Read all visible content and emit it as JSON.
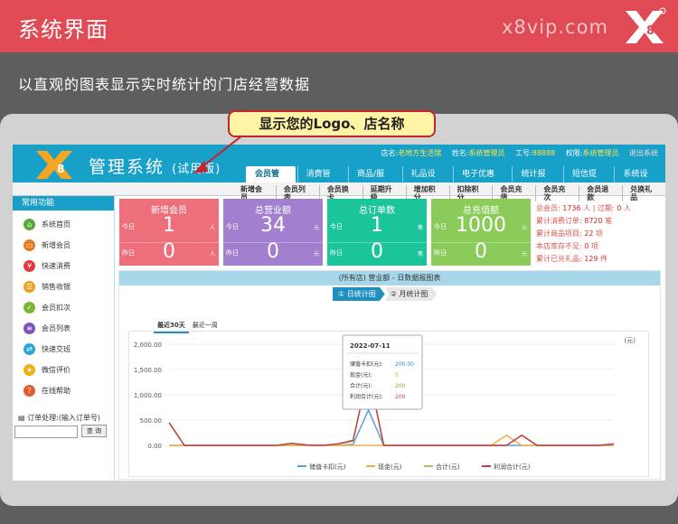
{
  "banner": {
    "title": "系统界面",
    "site": "x8vip.com",
    "logo": "X8"
  },
  "subtitle": "以直观的图表显示实时统计的门店经营数据",
  "callout": "显示您的Logo、店名称",
  "app": {
    "logo": "X8",
    "title": "管理系统",
    "title_suffix": "(试用版)",
    "info": [
      {
        "label": "店名:",
        "value": "老地方生活馆"
      },
      {
        "label": "姓名:",
        "value": "系统管理员"
      },
      {
        "label": "工号:",
        "value": "88888"
      },
      {
        "label": "权限:",
        "value": "系统管理员"
      }
    ],
    "exit": "退出系统",
    "main_tabs": [
      "会员管理",
      "消费管理",
      "商品/服务",
      "礼品设置",
      "电子优惠券",
      "统计报表",
      "短信提醒",
      "系统设置"
    ],
    "sub_tabs": [
      "新增会员",
      "会员列表",
      "会员换卡",
      "延期升级",
      "增加积分",
      "扣除积分",
      "会员充值",
      "会员充次",
      "会员退款",
      "兑换礼品"
    ],
    "sidebar": {
      "title": "常用功能",
      "items": [
        {
          "label": "系统首页",
          "icon": "home-icon",
          "color": "#5aa83a"
        },
        {
          "label": "新增会员",
          "icon": "member-card-icon",
          "color": "#e8791e"
        },
        {
          "label": "快速消费",
          "icon": "yen-icon",
          "color": "#e0383d"
        },
        {
          "label": "销售收银",
          "icon": "cash-icon",
          "color": "#f0a020"
        },
        {
          "label": "会员扣次",
          "icon": "check-icon",
          "color": "#7ab630"
        },
        {
          "label": "会员列表",
          "icon": "list-icon",
          "color": "#8050c0"
        },
        {
          "label": "快速交班",
          "icon": "shift-icon",
          "color": "#2aa6d6"
        },
        {
          "label": "微信评价",
          "icon": "star-icon",
          "color": "#f0b010"
        },
        {
          "label": "在线帮助",
          "icon": "help-icon",
          "color": "#e55a2b"
        }
      ],
      "order_label": "订单处理:(输入订单号)",
      "order_button": "查 询"
    },
    "cards": [
      {
        "title": "新增会员",
        "color": "#ee6f7c",
        "today_label": "今日",
        "today": "1",
        "yesterday_label": "昨日",
        "yesterday": "0",
        "unit": "人"
      },
      {
        "title": "总营业额",
        "color": "#a27fcf",
        "today_label": "今日",
        "today": "34",
        "yesterday_label": "昨日",
        "yesterday": "0",
        "unit": "元"
      },
      {
        "title": "总订单数",
        "color": "#1cc49a",
        "today_label": "今日",
        "today": "1",
        "yesterday_label": "昨日",
        "yesterday": "0",
        "unit": "笔"
      },
      {
        "title": "总充值额",
        "color": "#8acb5a",
        "today_label": "今日",
        "today": "1000",
        "yesterday_label": "昨日",
        "yesterday": "0",
        "unit": "元"
      }
    ],
    "summary": [
      {
        "label": "总会员:",
        "value": "1736",
        "unit": "人 | 过期:",
        "value2": "0",
        "unit2": "人"
      },
      {
        "label": "累计消费订单:",
        "value": "8720",
        "unit": "笔"
      },
      {
        "label": "累计商品项目:",
        "value": "22",
        "unit": "项"
      },
      {
        "label": "本店库存不足:",
        "value": "0",
        "unit": "项"
      },
      {
        "label": "累计已兑礼品:",
        "value": "129",
        "unit": "件"
      }
    ],
    "panel_title": "(所有店) 营业额 - 日数据报图表",
    "switch": [
      {
        "label": "① 日统计图"
      },
      {
        "label": "② 月统计图"
      }
    ],
    "ranges": [
      "最近30天",
      "最近一周"
    ]
  },
  "chart_data": {
    "type": "line",
    "ylabel": "(元)",
    "ylim": [
      0,
      2000
    ],
    "yticks": [
      "2,000.00",
      "1,500.00",
      "1,000.00",
      "500.00",
      "0.00"
    ],
    "series": [
      {
        "name": "储值卡扣(元)",
        "color": "#5aa0d8",
        "values": [
          0,
          0,
          0,
          0,
          0,
          0,
          0,
          0,
          0,
          0,
          0,
          1,
          20,
          700,
          0,
          0,
          0,
          0,
          0,
          0,
          0,
          0,
          0,
          0,
          0,
          0,
          0,
          0,
          0,
          0
        ]
      },
      {
        "name": "现金(元)",
        "color": "#f0b040",
        "values": [
          0,
          0,
          0,
          0,
          0,
          0,
          0,
          0,
          0,
          0,
          0,
          0,
          0,
          0,
          0,
          0,
          0,
          0,
          0,
          0,
          0,
          0,
          200,
          0,
          0,
          0,
          0,
          0,
          0,
          0
        ]
      },
      {
        "name": "合计(元)",
        "color": "#9acd50",
        "values": [
          450,
          0,
          0,
          0,
          0,
          0,
          0,
          0,
          40,
          10,
          0,
          30,
          80,
          1500,
          0,
          0,
          0,
          0,
          0,
          0,
          0,
          0,
          0,
          200,
          0,
          0,
          0,
          0,
          0,
          30
        ]
      },
      {
        "name": "利润合计(元)",
        "color": "#c0404a",
        "values": [
          450,
          0,
          0,
          0,
          0,
          0,
          0,
          0,
          40,
          10,
          0,
          30,
          100,
          1450,
          0,
          0,
          0,
          0,
          0,
          0,
          0,
          0,
          0,
          200,
          0,
          0,
          0,
          0,
          0,
          30
        ]
      }
    ],
    "tooltip": {
      "date": "2022-07-11",
      "rows": [
        {
          "label": "储值卡扣(元):",
          "value": "200.00",
          "color": "#2a8ad0"
        },
        {
          "label": "现金(元):",
          "value": "0",
          "color": "#e0a020"
        },
        {
          "label": "合计(元):",
          "value": "200",
          "color": "#7ab630"
        },
        {
          "label": "利润合计(元):",
          "value": "200",
          "color": "#c0404a"
        }
      ]
    }
  }
}
